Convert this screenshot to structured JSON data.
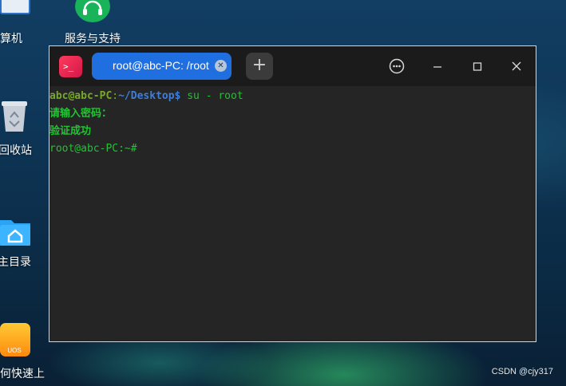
{
  "desktop": {
    "icons": [
      {
        "label": "计算机"
      },
      {
        "label": "服务与支持"
      },
      {
        "label": "回收站"
      },
      {
        "label": "主目录"
      },
      {
        "label": "如何快速上",
        "badge": "UOS"
      }
    ]
  },
  "window": {
    "tab_title": "root@abc-PC: /root",
    "colors": {
      "tab_accent": "#1f6fe0",
      "app_icon": "#e0234f",
      "prompt_user": "#78a82a",
      "prompt_path": "#3e7ed9",
      "output_green": "#22c234"
    }
  },
  "terminal": {
    "line1": {
      "user_host": "abc@abc-PC",
      "colon": ":",
      "path": "~/Desktop$",
      "command": " su - root"
    },
    "line2": "请输入密码：",
    "line3": "验证成功",
    "line4": "root@abc-PC:~#"
  },
  "watermark": "CSDN @cjy317"
}
